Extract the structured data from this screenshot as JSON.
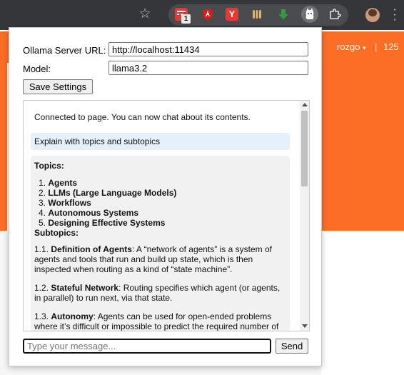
{
  "browser": {
    "extension_badge": "1",
    "extension_y_label": "Y",
    "icons": [
      "star-icon",
      "todo-extension-icon",
      "angular-extension-icon",
      "y-extension-icon",
      "sound-extension-icon",
      "download-extension-icon",
      "ollama-extension-icon",
      "puzzle-icon",
      "profile-avatar",
      "menu-icon"
    ]
  },
  "page": {
    "username": "rozgo",
    "dropdown_caret": "▾",
    "separator": "|",
    "count": "125"
  },
  "settings": {
    "server_label": "Ollama Server URL:",
    "server_value": "http://localhost:11434",
    "model_label": "Model:",
    "model_value": "llama3.2",
    "save_label": "Save Settings"
  },
  "chat": {
    "system_message": "Connected to page. You can now chat about its contents.",
    "user_message": "Explain with topics and subtopics",
    "response": {
      "topics_heading": "Topics:",
      "topics": [
        {
          "num": "1.",
          "name": "Agents"
        },
        {
          "num": "2.",
          "name": "LLMs (Large Language Models)"
        },
        {
          "num": "3.",
          "name": "Workflows"
        },
        {
          "num": "4.",
          "name": "Autonomous Systems"
        },
        {
          "num": "5.",
          "name": "Designing Effective Systems"
        }
      ],
      "subtopics_heading": "Subtopics:",
      "subtopics": [
        {
          "num": "1.1.",
          "title": "Definition of Agents",
          "text": ": A “network of agents” is a system of agents and tools that run and build up state, which is then inspected when routing as a kind of “state machine”."
        },
        {
          "num": "1.2.",
          "title": "Stateful Network",
          "text": ": Routing specifies which agent (or agents, in parallel) to run next, via that state."
        },
        {
          "num": "1.3.",
          "title": "Autonomy",
          "text": ": Agents can be used for open-ended problems where it’s difficult or impossible to predict the required number of"
        }
      ]
    }
  },
  "composer": {
    "placeholder": "Type your message...",
    "send_label": "Send"
  }
}
